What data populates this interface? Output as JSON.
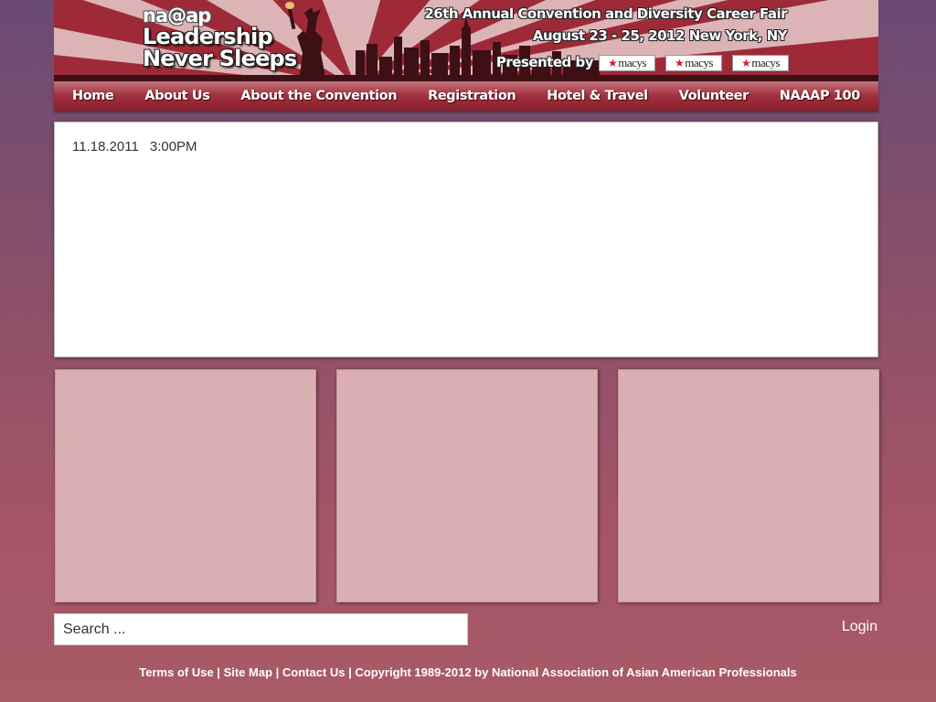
{
  "header": {
    "logo_text": "na@ap",
    "tagline_line1": "Leadership",
    "tagline_line2": "Never Sleeps",
    "event_title": "26th Annual Convention and Diversity Career Fair",
    "event_date": "August 23 - 25, 2012 New York, NY",
    "presented_by": "Presented by",
    "sponsors": [
      "macys",
      "macys",
      "macys"
    ]
  },
  "nav": {
    "items": [
      "Home",
      "About Us",
      "About the Convention",
      "Registration",
      "Hotel & Travel",
      "Volunteer",
      "NAAAP 100"
    ]
  },
  "main": {
    "news_date": "11.18.2011",
    "news_time": "3:00PM"
  },
  "search": {
    "placeholder": "Search ..."
  },
  "login_label": "Login",
  "footer": {
    "links": [
      "Terms of Use",
      "Site Map",
      "Contact Us"
    ],
    "copyright": "Copyright 1989-2012 by National Association of Asian American Professionals"
  },
  "colors": {
    "accent": "#8a1f2c",
    "panel": "#d9afb1",
    "logo_at": "#d21d2a"
  },
  "icons": {
    "banner_art": "statue-of-liberty-skyline"
  }
}
